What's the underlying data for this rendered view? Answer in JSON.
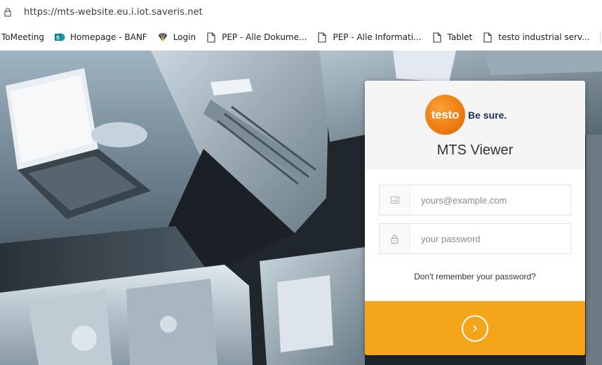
{
  "browser": {
    "url": "https://mts-website.eu.i.iot.saveris.net"
  },
  "bookmarks": [
    {
      "label": "ToMeeting",
      "icon": "none"
    },
    {
      "label": "Homepage - BANF",
      "icon": "sharepoint-icon"
    },
    {
      "label": "Login",
      "icon": "shell-icon"
    },
    {
      "label": "PEP - Alle Dokume...",
      "icon": "page-icon"
    },
    {
      "label": "PEP - Alle Informati...",
      "icon": "page-icon"
    },
    {
      "label": "Tablet",
      "icon": "page-icon"
    },
    {
      "label": "testo industrial serv...",
      "icon": "page-icon"
    }
  ],
  "login": {
    "logo_text": "testo",
    "logo_tagline": "Be sure.",
    "title": "MTS Viewer",
    "email_placeholder": "yours@example.com",
    "password_placeholder": "your password",
    "forgot_label": "Don't remember your password?"
  },
  "colors": {
    "accent": "#f5a51a",
    "logo_orange": "#ef7e12",
    "tagline_navy": "#1c2d5a"
  }
}
